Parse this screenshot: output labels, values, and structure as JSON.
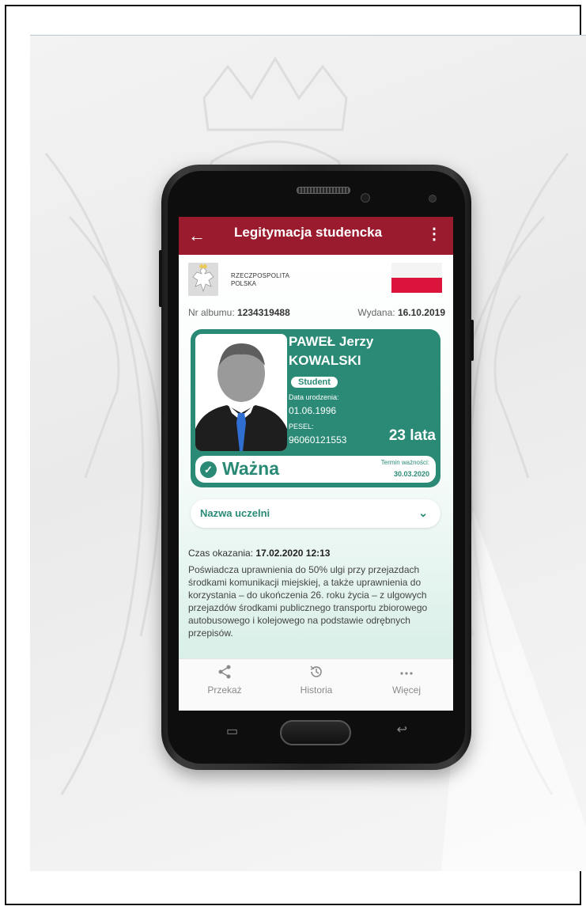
{
  "app": {
    "title": "Legitymacja studencka",
    "back_icon": "←",
    "more_icon": "⋮"
  },
  "header": {
    "country_line1": "RZECZPOSPOLITA",
    "country_line2": "POLSKA"
  },
  "meta": {
    "album_label": "Nr albumu:",
    "album_value": "1234319488",
    "issued_label": "Wydana:",
    "issued_value": "16.10.2019"
  },
  "card": {
    "first_names": "PAWEŁ Jerzy",
    "last_name": "KOWALSKI",
    "role_badge": "Student",
    "birth_label": "Data urodzenia:",
    "birth_value": "01.06.1996",
    "pesel_label": "PESEL:",
    "pesel_value": "96060121553",
    "age": "23 lata",
    "status": "Ważna",
    "validity_label": "Termin ważności:",
    "validity_value": "30.03.2020"
  },
  "university": {
    "label": "Nazwa uczelni",
    "chevron": "⌄"
  },
  "presentation": {
    "label": "Czas okazania:",
    "value": "17.02.2020 12:13"
  },
  "description": "Poświadcza uprawnienia do 50% ulgi przy przejazdach środkami komunikacji miejskiej, a także uprawnienia do korzystania – do ukończenia 26. roku życia – z ulgowych przejazdów środkami publicznego transportu zbiorowego autobusowego i kolejowego na podstawie odrębnych przepisów.",
  "bottom_nav": [
    {
      "label": "Przekaż",
      "icon": "share-icon"
    },
    {
      "label": "Historia",
      "icon": "history-icon"
    },
    {
      "label": "Więcej",
      "icon": "more-horizontal-icon"
    }
  ],
  "colors": {
    "appbar": "#9a1b2e",
    "card_green": "#2a8a75",
    "flag_white": "#f4f4f4",
    "flag_red": "#dc143c"
  }
}
